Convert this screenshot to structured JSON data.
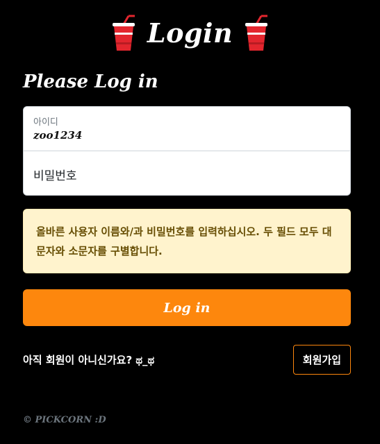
{
  "header": {
    "title": "Login",
    "left_icon": "soda-cup-icon",
    "right_icon": "soda-cup-icon"
  },
  "form": {
    "heading": "Please Log in",
    "username": {
      "label": "아이디",
      "value": "zoo1234"
    },
    "password": {
      "placeholder": "비밀번호"
    }
  },
  "alert": {
    "message": "올바른 사용자 이름와/과 비밀번호를 입력하십시오. 두 필드 모두 대문자와 소문자를 구별합니다."
  },
  "login_button": {
    "label": "Log in"
  },
  "signup": {
    "prompt": "아직 회원이 아니신가요? ಥ_ಥ",
    "button_label": "회원가입"
  },
  "footer": {
    "text": "© PICKCORN :D"
  },
  "colors": {
    "background": "#000000",
    "accent": "#fd870d",
    "alert_bg": "#fff3cd",
    "alert_text": "#664d03",
    "cup_red": "#e3262e"
  }
}
